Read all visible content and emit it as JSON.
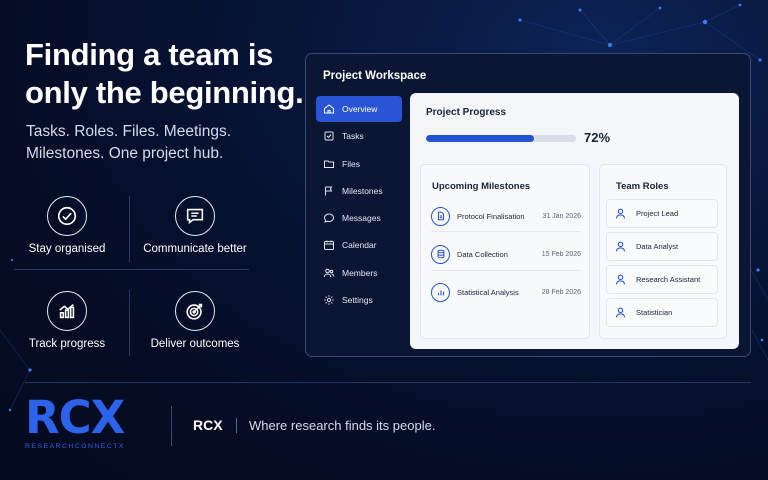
{
  "hero": {
    "title_line1": "Finding a team is",
    "title_line2": "only the beginning.",
    "subtitle_line1": "Tasks. Roles. Files. Meetings.",
    "subtitle_line2": "Milestones. One project hub."
  },
  "features": [
    {
      "label": "Stay organised",
      "icon": "check-circle-icon"
    },
    {
      "label": "Communicate better",
      "icon": "chat-icon"
    },
    {
      "label": "Track progress",
      "icon": "bar-chart-icon"
    },
    {
      "label": "Deliver outcomes",
      "icon": "target-icon"
    }
  ],
  "workspace": {
    "title": "Project Workspace",
    "nav": [
      {
        "label": "Overview",
        "icon": "home-icon",
        "active": true
      },
      {
        "label": "Tasks",
        "icon": "checkbox-icon"
      },
      {
        "label": "Files",
        "icon": "folder-icon"
      },
      {
        "label": "Milestones",
        "icon": "flag-icon"
      },
      {
        "label": "Messages",
        "icon": "message-icon"
      },
      {
        "label": "Calendar",
        "icon": "calendar-icon"
      },
      {
        "label": "Members",
        "icon": "members-icon"
      },
      {
        "label": "Settings",
        "icon": "gear-icon"
      }
    ],
    "progress": {
      "title": "Project Progress",
      "percent_label": "72%",
      "value": 0.72
    },
    "milestones": {
      "title": "Upcoming Milestones",
      "items": [
        {
          "name": "Protocol Finalisation",
          "date": "31 Jan 2026",
          "icon": "document-icon"
        },
        {
          "name": "Data Collection",
          "date": "15 Feb 2026",
          "icon": "database-icon"
        },
        {
          "name": "Statistical Analysis",
          "date": "28 Feb 2026",
          "icon": "bar-chart-icon"
        }
      ]
    },
    "roles": {
      "title": "Team Roles",
      "items": [
        "Project Lead",
        "Data Analyst",
        "Research Assistant",
        "Statistician"
      ]
    }
  },
  "footer": {
    "logo_text": "RCX",
    "logo_subtext": "RESEARCHCONNECTX",
    "brand": "RCX",
    "tagline": "Where research finds its people."
  },
  "colors": {
    "background": "#050d26",
    "accent": "#2a54d6",
    "logo": "#2d62ea",
    "panel": "#f4f6fa"
  }
}
